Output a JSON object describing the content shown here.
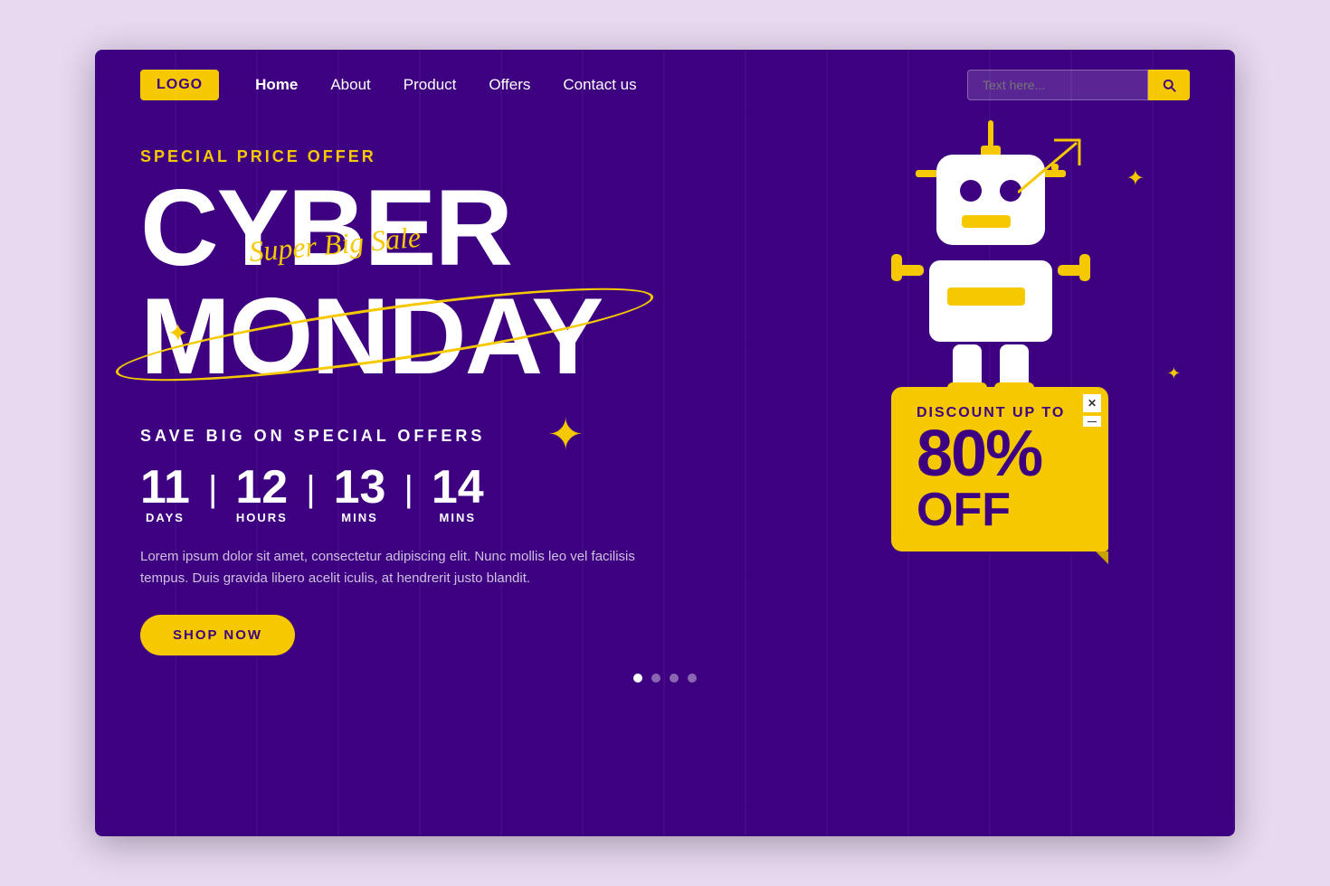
{
  "page": {
    "background_color": "#e8d8f0",
    "main_bg": "#3d0080"
  },
  "navbar": {
    "logo_label": "LOGO",
    "links": [
      {
        "label": "Home",
        "active": true
      },
      {
        "label": "About",
        "active": false
      },
      {
        "label": "Product",
        "active": false
      },
      {
        "label": "Offers",
        "active": false
      },
      {
        "label": "Contact us",
        "active": false
      }
    ],
    "search_placeholder": "Text here..."
  },
  "hero": {
    "special_offer": "SPECIAL PRICE OFFER",
    "title_line1": "CYBER",
    "title_line2": "MONDAY",
    "cursive_label": "Super Big Sale",
    "save_big": "SAVE BIG ON SPECIAL OFFERS",
    "countdown": {
      "days": "11",
      "days_label": "DAYS",
      "hours": "12",
      "hours_label": "HOURS",
      "mins1": "13",
      "mins1_label": "MINS",
      "mins2": "14",
      "mins2_label": "MINS"
    },
    "lorem_text": "Lorem ipsum dolor sit amet, consectetur adipiscing elit. Nunc mollis leo vel facilisis tempus. Duis gravida libero acelit iculis, at hendrerit justo blandit.",
    "shop_now_label": "SHOP NOW"
  },
  "discount": {
    "up_to": "DISCOUNT UP TO",
    "percent": "80%",
    "off": "OFF"
  },
  "dots": [
    true,
    false,
    false,
    false
  ]
}
